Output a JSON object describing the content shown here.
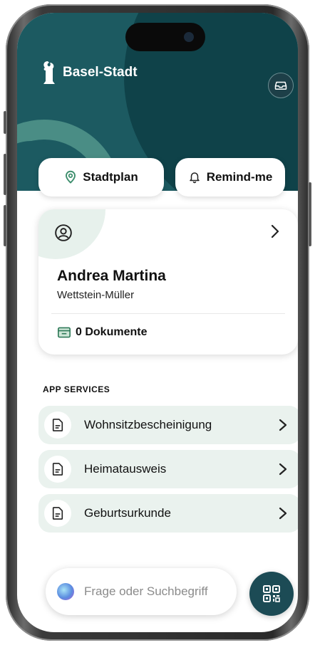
{
  "header": {
    "app_title": "Basel-Stadt",
    "icons": {
      "logo": "basel-crozier-logo",
      "inbox": "inbox-icon"
    }
  },
  "quick_actions": [
    {
      "label": "Stadtplan",
      "icon": "map-pin-icon"
    },
    {
      "label": "Remind-me",
      "icon": "bell-icon"
    }
  ],
  "profile_card": {
    "name": "Andrea Martina",
    "surname": "Wettstein-Müller",
    "documents_label": "0 Dokumente",
    "icons": {
      "person": "person-circle-icon",
      "chevron": "chevron-right-icon",
      "documents": "document-tray-icon"
    }
  },
  "app_services": {
    "title": "APP SERVICES",
    "items": [
      {
        "label": "Wohnsitzbescheinigung"
      },
      {
        "label": "Heimatausweis"
      },
      {
        "label": "Geburtsurkunde"
      }
    ]
  },
  "search": {
    "placeholder": "Frage oder Suchbegriff",
    "icon": "assistant-orb-icon"
  },
  "qr_button": {
    "icon": "qr-code-icon"
  },
  "colors": {
    "header_teal": "#1c5a61",
    "header_dark": "#0f4249",
    "accent_green": "#3f8f6e",
    "service_bg": "#eaf2ee",
    "qr_bg": "#1c4b55"
  }
}
